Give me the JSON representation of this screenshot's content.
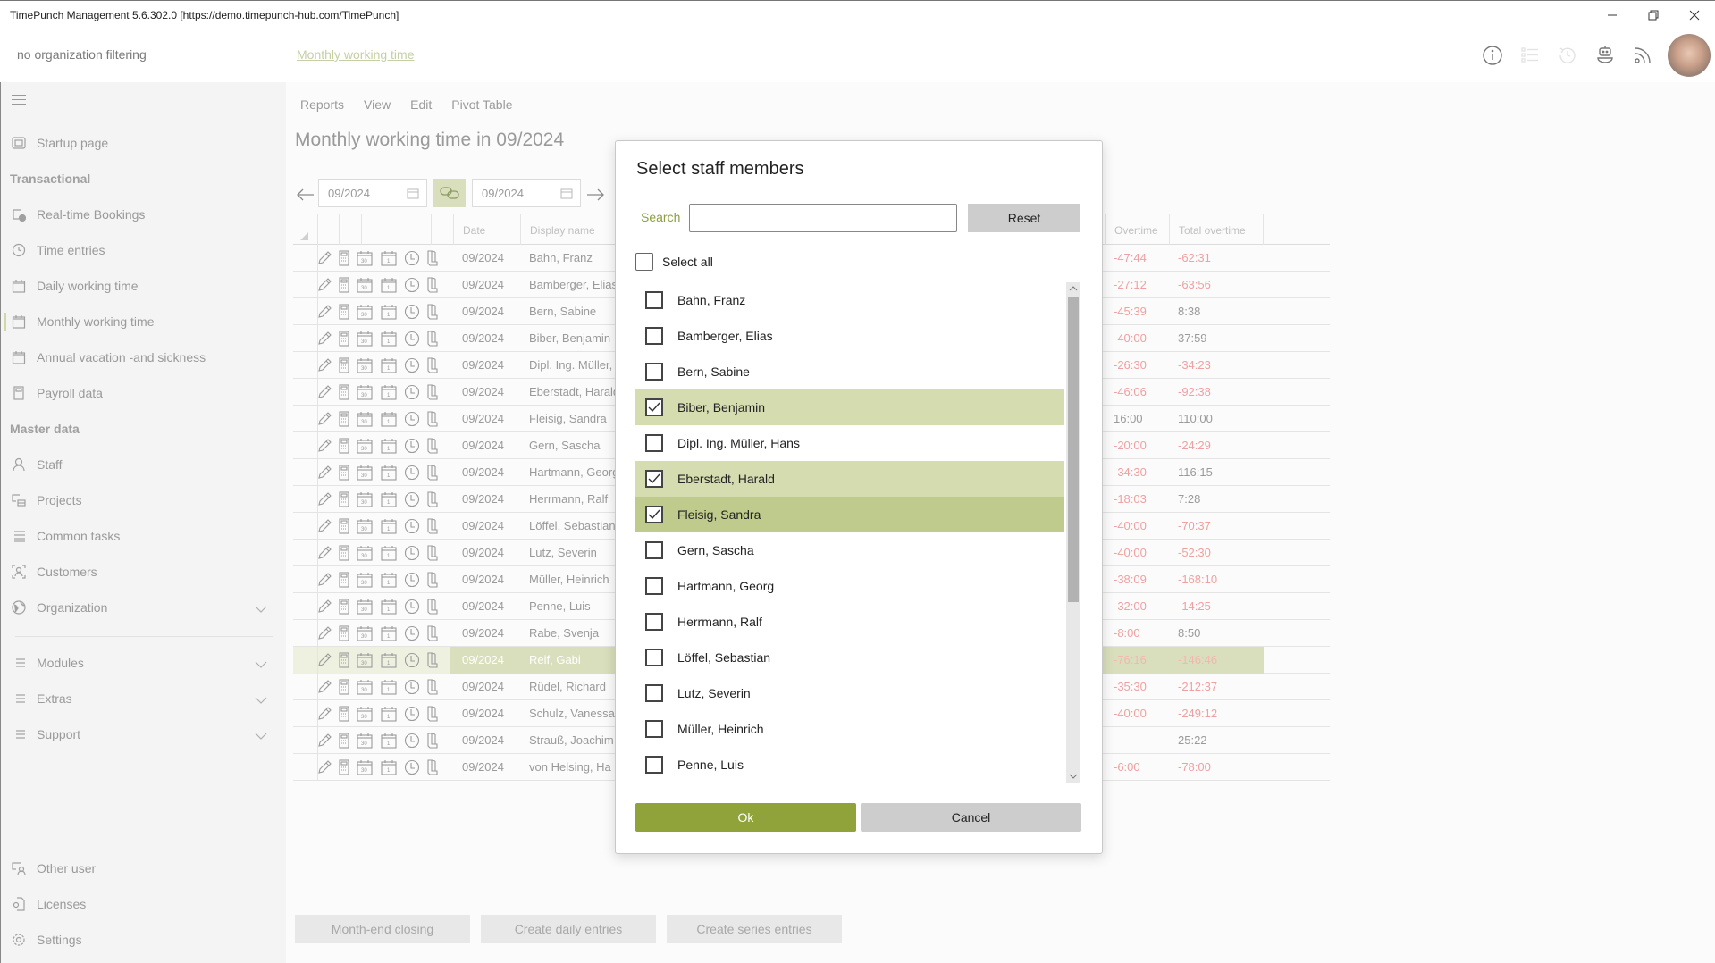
{
  "window": {
    "title": "TimePunch Management 5.6.302.0 [https://demo.timepunch-hub.com/TimePunch]",
    "controls": [
      "minimize",
      "restore",
      "close"
    ]
  },
  "header": {
    "org_filter": "no organization filtering",
    "breadcrumb": "Monthly working time",
    "icons": [
      "info-icon",
      "checklist-icon",
      "history-icon",
      "bot-icon",
      "rss-icon",
      "user-avatar"
    ]
  },
  "sidebar": {
    "startup": "Startup page",
    "section_transactional": "Transactional",
    "transactional": [
      "Real-time Bookings",
      "Time entries",
      "Daily working time",
      "Monthly working time",
      "Annual vacation -and sickness",
      "Payroll data"
    ],
    "active_item": "Monthly working time",
    "section_master": "Master data",
    "master": [
      "Staff",
      "Projects",
      "Common tasks",
      "Customers",
      "Organization"
    ],
    "groups": [
      "Modules",
      "Extras",
      "Support"
    ],
    "bottom": [
      "Other user",
      "Licenses",
      "Settings"
    ]
  },
  "main": {
    "menu": [
      "Reports",
      "View",
      "Edit",
      "Pivot Table"
    ],
    "title": "Monthly working time in 09/2024",
    "date_from": "09/2024",
    "date_to": "09/2024",
    "columns": {
      "date": "Date",
      "display_name": "Display name",
      "overtime": "Overtime",
      "total_overtime": "Total overtime"
    },
    "rows": [
      {
        "date": "09/2024",
        "name": "Bahn, Franz",
        "overtime": "-47:44",
        "total": "-62:31"
      },
      {
        "date": "09/2024",
        "name": "Bamberger, Elias",
        "overtime": "-27:12",
        "total": "-63:56"
      },
      {
        "date": "09/2024",
        "name": "Bern, Sabine",
        "overtime": "-45:39",
        "total": "8:38"
      },
      {
        "date": "09/2024",
        "name": "Biber, Benjamin",
        "overtime": "-40:00",
        "total": "37:59"
      },
      {
        "date": "09/2024",
        "name": "Dipl. Ing. Müller, Hans",
        "overtime": "-26:30",
        "total": "-34:23"
      },
      {
        "date": "09/2024",
        "name": "Eberstadt, Harald",
        "overtime": "-46:06",
        "total": "-92:38"
      },
      {
        "date": "09/2024",
        "name": "Fleisig, Sandra",
        "overtime": "16:00",
        "total": "110:00"
      },
      {
        "date": "09/2024",
        "name": "Gern, Sascha",
        "overtime": "-20:00",
        "total": "-24:29"
      },
      {
        "date": "09/2024",
        "name": "Hartmann, Georg",
        "overtime": "-34:30",
        "total": "116:15"
      },
      {
        "date": "09/2024",
        "name": "Herrmann, Ralf",
        "overtime": "-18:03",
        "total": "7:28"
      },
      {
        "date": "09/2024",
        "name": "Löffel, Sebastian",
        "overtime": "-40:00",
        "total": "-70:37"
      },
      {
        "date": "09/2024",
        "name": "Lutz, Severin",
        "overtime": "-40:00",
        "total": "-52:30"
      },
      {
        "date": "09/2024",
        "name": "Müller, Heinrich",
        "overtime": "-38:09",
        "total": "-168:10"
      },
      {
        "date": "09/2024",
        "name": "Penne, Luis",
        "overtime": "-32:00",
        "total": "-14:25"
      },
      {
        "date": "09/2024",
        "name": "Rabe, Svenja",
        "overtime": "-8:00",
        "total": "8:50"
      },
      {
        "date": "09/2024",
        "name": "Reif, Gabi",
        "overtime": "-76:16",
        "total": "-146:46",
        "selected": true
      },
      {
        "date": "09/2024",
        "name": "Rüdel, Richard",
        "overtime": "-35:30",
        "total": "-212:37"
      },
      {
        "date": "09/2024",
        "name": "Schulz, Vanessa",
        "overtime": "-40:00",
        "total": "-249:12"
      },
      {
        "date": "09/2024",
        "name": "Strauß, Joachim",
        "overtime": "",
        "total": "25:22"
      },
      {
        "date": "09/2024",
        "name": "von Helsing, Ha",
        "overtime": "-6:00",
        "total": "-78:00"
      }
    ],
    "bottom_buttons": [
      "Month-end closing",
      "Create daily entries",
      "Create series entries"
    ]
  },
  "dialog": {
    "title": "Select staff members",
    "search_label": "Search",
    "search_value": "",
    "search_placeholder": "",
    "reset_label": "Reset",
    "select_all_label": "Select all",
    "select_all_checked": false,
    "staff": [
      {
        "name": "Bahn, Franz",
        "checked": false
      },
      {
        "name": "Bamberger, Elias",
        "checked": false
      },
      {
        "name": "Bern, Sabine",
        "checked": false
      },
      {
        "name": "Biber, Benjamin",
        "checked": true
      },
      {
        "name": "Dipl. Ing. Müller, Hans",
        "checked": false
      },
      {
        "name": "Eberstadt, Harald",
        "checked": true
      },
      {
        "name": "Fleisig, Sandra",
        "checked": true,
        "focused": true
      },
      {
        "name": "Gern, Sascha",
        "checked": false
      },
      {
        "name": "Hartmann, Georg",
        "checked": false
      },
      {
        "name": "Herrmann, Ralf",
        "checked": false
      },
      {
        "name": "Löffel, Sebastian",
        "checked": false
      },
      {
        "name": "Lutz, Severin",
        "checked": false
      },
      {
        "name": "Müller, Heinrich",
        "checked": false
      },
      {
        "name": "Penne, Luis",
        "checked": false
      }
    ],
    "ok_label": "Ok",
    "cancel_label": "Cancel"
  }
}
